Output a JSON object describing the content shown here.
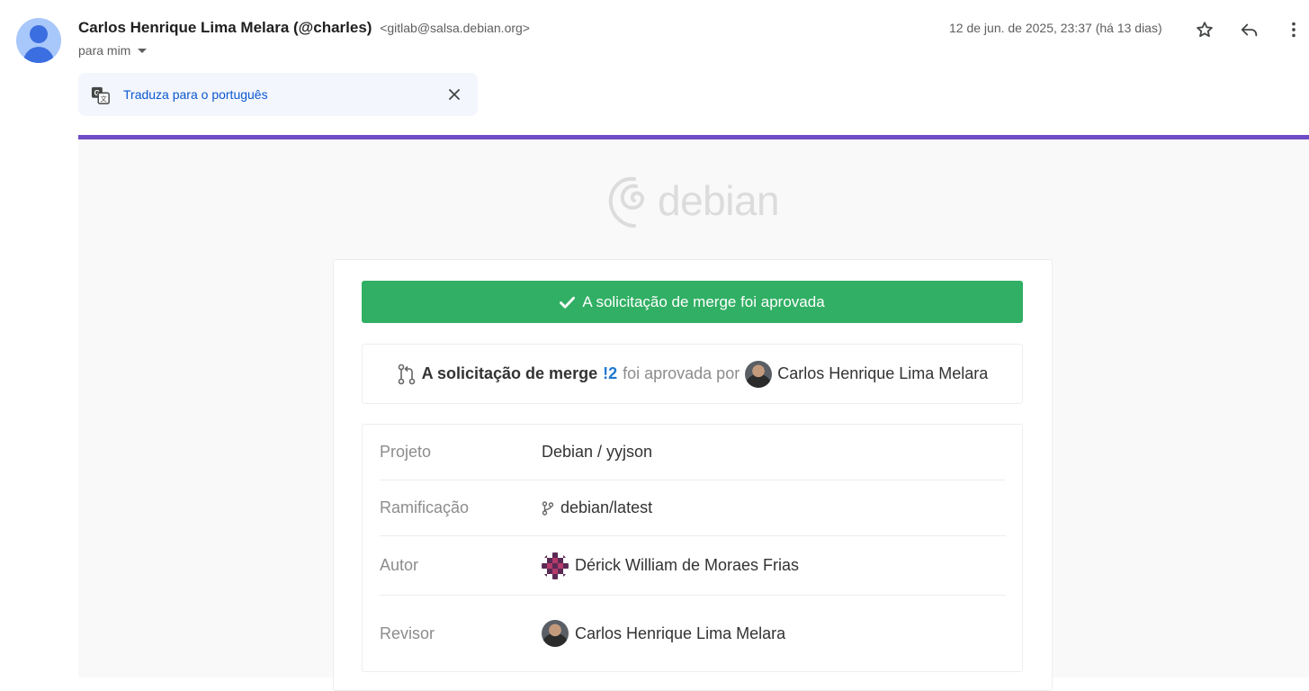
{
  "header": {
    "sender_name": "Carlos Henrique Lima Melara (@charles)",
    "sender_address": "<gitlab@salsa.debian.org>",
    "to_line": "para mim",
    "date": "12 de jun. de 2025, 23:37 (há 13 dias)",
    "icons": [
      "star-icon",
      "reply-icon",
      "more-vert-icon"
    ]
  },
  "translate": {
    "label": "Traduza para o português",
    "icon": "translate-icon"
  },
  "email": {
    "accent_color": "#6f4cc5",
    "logo_text": "debian",
    "banner": "A solicitação de merge foi aprovada",
    "banner_color": "#31af64",
    "approval": {
      "prefix": "A solicitação de merge",
      "mr_ref": "!2",
      "middle": "foi aprovada por",
      "approver": "Carlos Henrique Lima Melara"
    },
    "details": [
      {
        "label": "Projeto",
        "value": "Debian / yyjson"
      },
      {
        "label": "Ramificação",
        "value": "debian/latest"
      },
      {
        "label": "Autor",
        "value": "Dérick William de Moraes Frias"
      },
      {
        "label": "Revisor",
        "value": "Carlos Henrique Lima Melara"
      }
    ]
  }
}
